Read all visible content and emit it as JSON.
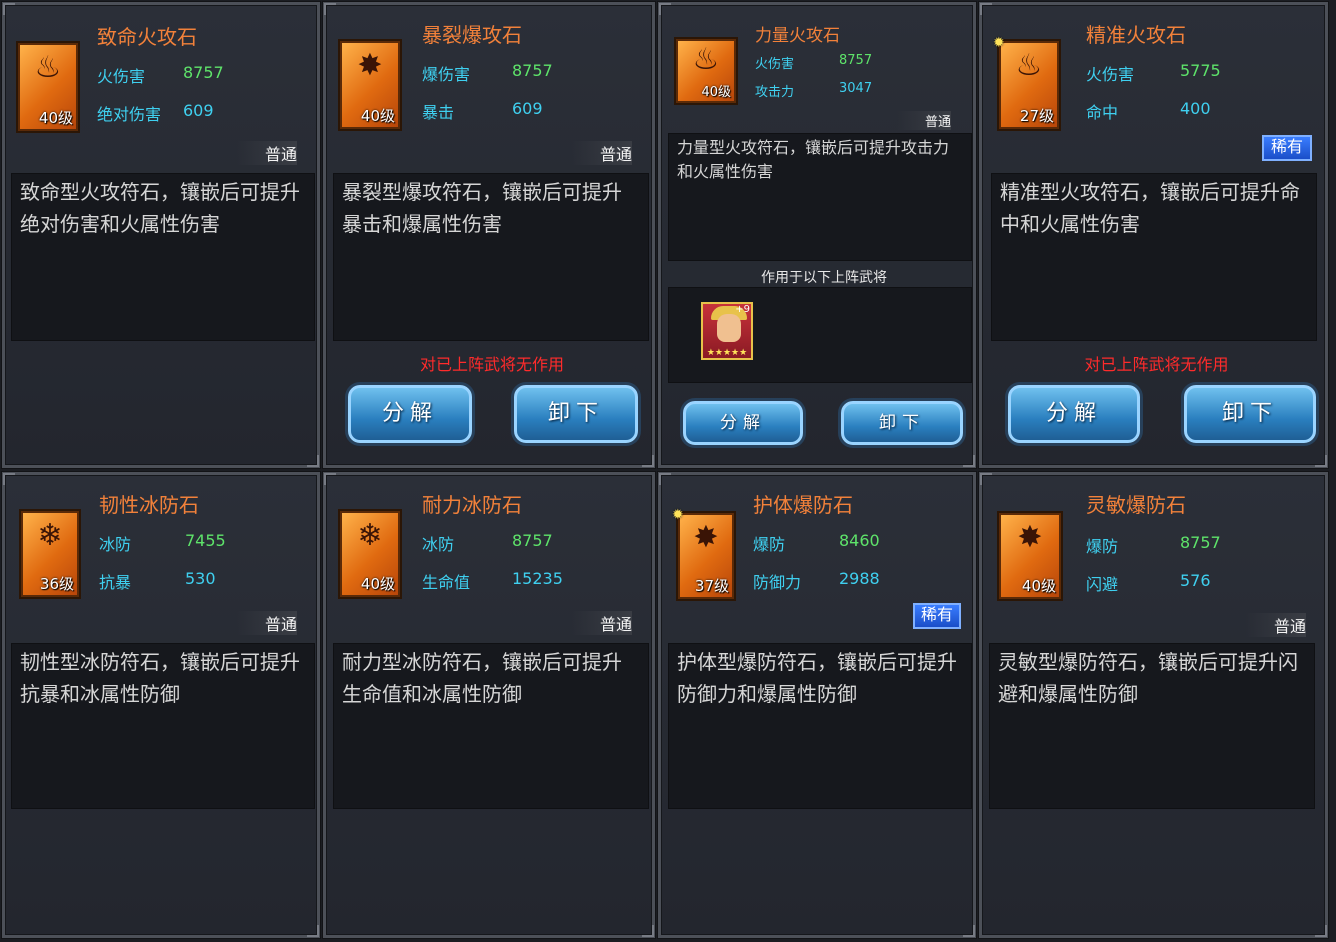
{
  "cards": [
    {
      "title": "致命火攻石",
      "level": "40级",
      "icon": "fire-rune-icon",
      "stats": [
        {
          "name": "火伤害",
          "value": "8757"
        },
        {
          "name": "绝对伤害",
          "value": "609"
        }
      ],
      "grade": "普通",
      "description": "致命型火攻符石，镶嵌后可提升绝对伤害和火属性伤害"
    },
    {
      "title": "暴裂爆攻石",
      "level": "40级",
      "icon": "burst-rune-icon",
      "stats": [
        {
          "name": "爆伤害",
          "value": "8757"
        },
        {
          "name": "暴击",
          "value": "609"
        }
      ],
      "grade": "普通",
      "description": "暴裂型爆攻符石，镶嵌后可提升暴击和爆属性伤害",
      "warning": "对已上阵武将无作用",
      "buttons": [
        "分解",
        "卸下"
      ]
    },
    {
      "title": "力量火攻石",
      "level": "40级",
      "icon": "fire-rune-icon",
      "stats": [
        {
          "name": "火伤害",
          "value": "8757"
        },
        {
          "name": "攻击力",
          "value": "3047"
        }
      ],
      "grade": "普通",
      "description": "力量型火攻符石，镶嵌后可提升攻击力和火属性伤害",
      "applies_label": "作用于以下上阵武将",
      "hero_plus": "+9",
      "hero_stars": "★★★★★",
      "buttons": [
        "分解",
        "卸下"
      ]
    },
    {
      "title": "精准火攻石",
      "level": "27级",
      "icon": "fire-rune-icon",
      "stats": [
        {
          "name": "火伤害",
          "value": "5775"
        },
        {
          "name": "命中",
          "value": "400"
        }
      ],
      "grade": "稀有",
      "description": "精准型火攻符石，镶嵌后可提升命中和火属性伤害",
      "warning": "对已上阵武将无作用",
      "buttons": [
        "分解",
        "卸下"
      ]
    },
    {
      "title": "韧性冰防石",
      "level": "36级",
      "icon": "ice-rune-icon",
      "stats": [
        {
          "name": "冰防",
          "value": "7455"
        },
        {
          "name": "抗暴",
          "value": "530"
        }
      ],
      "grade": "普通",
      "description": "韧性型冰防符石，镶嵌后可提升抗暴和冰属性防御"
    },
    {
      "title": "耐力冰防石",
      "level": "40级",
      "icon": "ice-rune-icon",
      "stats": [
        {
          "name": "冰防",
          "value": "8757"
        },
        {
          "name": "生命值",
          "value": "15235"
        }
      ],
      "grade": "普通",
      "description": "耐力型冰防符石，镶嵌后可提升生命值和冰属性防御"
    },
    {
      "title": "护体爆防石",
      "level": "37级",
      "icon": "burst-rune-icon",
      "stats": [
        {
          "name": "爆防",
          "value": "8460"
        },
        {
          "name": "防御力",
          "value": "2988"
        }
      ],
      "grade": "稀有",
      "description": "护体型爆防符石，镶嵌后可提升防御力和爆属性防御"
    },
    {
      "title": "灵敏爆防石",
      "level": "40级",
      "icon": "burst-rune-icon",
      "stats": [
        {
          "name": "爆防",
          "value": "8757"
        },
        {
          "name": "闪避",
          "value": "576"
        }
      ],
      "grade": "普通",
      "description": "灵敏型爆防符石，镶嵌后可提升闪避和爆属性防御"
    }
  ],
  "glyphs": {
    "fire": "♨",
    "burst": "✸",
    "ice": "❄"
  },
  "colors": {
    "title": "#f2813a",
    "stat_name": "#3fd0f0",
    "stat_value": "#5ee36a",
    "warning": "#ff2b2b",
    "button": "#2a7fbf",
    "rare_badge": "#2a62e0"
  }
}
